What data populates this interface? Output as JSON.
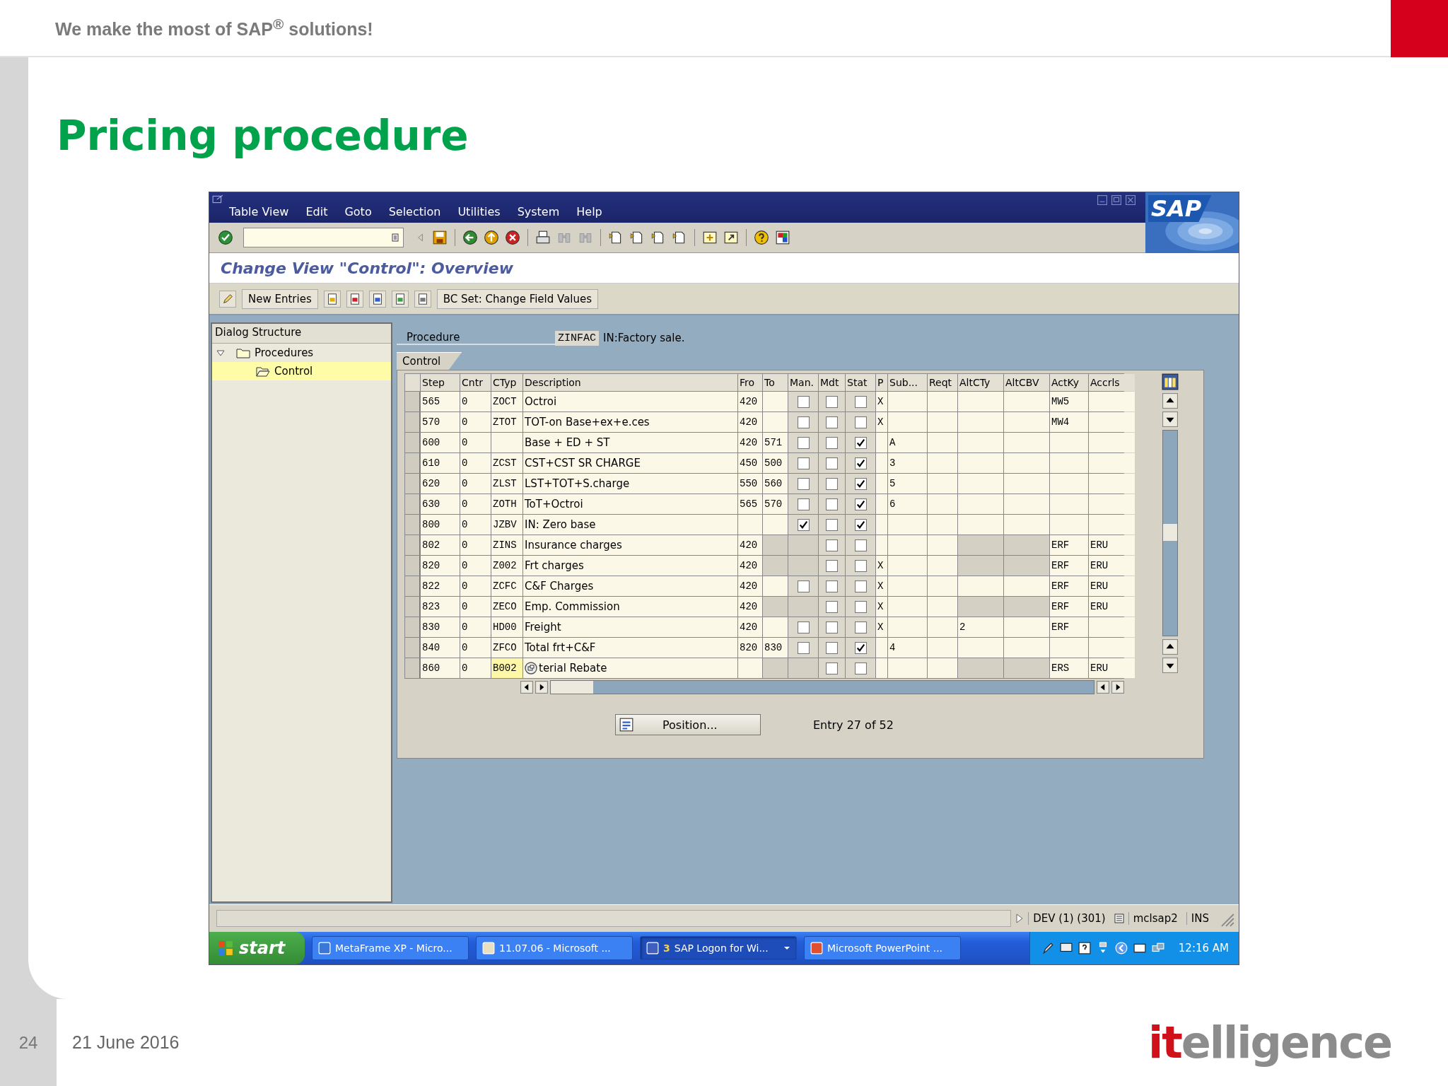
{
  "slide": {
    "tagline": "We make the most of SAP$^{®}$ solutions!",
    "title": "Pricing procedure",
    "page_number": "24",
    "date": "21 June 2016",
    "logo_parts": [
      "it",
      "elligence"
    ]
  },
  "sap": {
    "menu": [
      "Table View",
      "Edit",
      "Goto",
      "Selection",
      "Utilities",
      "System",
      "Help"
    ],
    "logo": "SAP",
    "screen_title": "Change View \"Control\": Overview",
    "new_entries_button": "New Entries",
    "bc_set_button": "BC Set: Change Field Values",
    "dialog_structure": {
      "title": "Dialog Structure",
      "tree": [
        {
          "label": "Procedures",
          "expanded": true,
          "selected": false,
          "children": [
            {
              "label": "Control",
              "selected": true
            }
          ]
        }
      ]
    },
    "procedure": {
      "label": "Procedure",
      "value": "ZINFAC",
      "description": "IN:Factory sale."
    },
    "tab": "Control",
    "table": {
      "columns": [
        "Step",
        "Cntr",
        "CTyp",
        "Description",
        "Fro",
        "To",
        "Man.",
        "Mdt",
        "Stat",
        "P",
        "Sub...",
        "Reqt",
        "AltCTy",
        "AltCBV",
        "ActKy",
        "Accrls"
      ],
      "rows": [
        {
          "step": "565",
          "cntr": "0",
          "ctyp": "ZOCT",
          "description": "Octroi",
          "fro": "420",
          "man": false,
          "mdt": false,
          "stat": false,
          "p": "X",
          "actky": "MW5",
          "locked": false,
          "focused": false
        },
        {
          "step": "570",
          "cntr": "0",
          "ctyp": "ZTOT",
          "description": "TOT-on Base+ex+e.ces",
          "fro": "420",
          "man": false,
          "mdt": false,
          "stat": false,
          "p": "X",
          "actky": "MW4",
          "locked": false,
          "focused": false
        },
        {
          "step": "600",
          "cntr": "0",
          "description": "Base + ED + ST",
          "fro": "420",
          "to": "571",
          "man": false,
          "mdt": false,
          "stat": true,
          "sub": "A",
          "locked": false,
          "focused": false
        },
        {
          "step": "610",
          "cntr": "0",
          "ctyp": "ZCST",
          "description": "CST+CST SR CHARGE",
          "fro": "450",
          "to": "500",
          "man": false,
          "mdt": false,
          "stat": true,
          "sub": "3",
          "locked": false,
          "focused": false
        },
        {
          "step": "620",
          "cntr": "0",
          "ctyp": "ZLST",
          "description": "LST+TOT+S.charge",
          "fro": "550",
          "to": "560",
          "man": false,
          "mdt": false,
          "stat": true,
          "sub": "5",
          "locked": false,
          "focused": false
        },
        {
          "step": "630",
          "cntr": "0",
          "ctyp": "ZOTH",
          "description": "ToT+Octroi",
          "fro": "565",
          "to": "570",
          "man": false,
          "mdt": false,
          "stat": true,
          "sub": "6",
          "locked": false,
          "focused": false
        },
        {
          "step": "800",
          "cntr": "0",
          "ctyp": "JZBV",
          "description": "IN: Zero base",
          "man": true,
          "mdt": false,
          "stat": true,
          "locked": false,
          "focused": false
        },
        {
          "step": "802",
          "cntr": "0",
          "ctyp": "ZINS",
          "description": "Insurance charges",
          "fro": "420",
          "mdt": false,
          "stat": false,
          "actky": "ERF",
          "accrls": "ERU",
          "locked": true,
          "focused": false
        },
        {
          "step": "820",
          "cntr": "0",
          "ctyp": "Z002",
          "description": "Frt charges",
          "fro": "420",
          "mdt": false,
          "stat": false,
          "p": "X",
          "actky": "ERF",
          "accrls": "ERU",
          "locked": true,
          "focused": false
        },
        {
          "step": "822",
          "cntr": "0",
          "ctyp": "ZCFC",
          "description": "C&F Charges",
          "fro": "420",
          "man": false,
          "mdt": false,
          "stat": false,
          "p": "X",
          "actky": "ERF",
          "accrls": "ERU",
          "locked": false,
          "focused": false
        },
        {
          "step": "823",
          "cntr": "0",
          "ctyp": "ZECO",
          "description": "Emp. Commission",
          "fro": "420",
          "mdt": false,
          "stat": false,
          "p": "X",
          "actky": "ERF",
          "accrls": "ERU",
          "locked": true,
          "focused": false
        },
        {
          "step": "830",
          "cntr": "0",
          "ctyp": "HD00",
          "description": "Freight",
          "fro": "420",
          "man": false,
          "mdt": false,
          "stat": false,
          "p": "X",
          "altcty": "2",
          "actky": "ERF",
          "locked": false,
          "focused": false
        },
        {
          "step": "840",
          "cntr": "0",
          "ctyp": "ZFCO",
          "description": "Total frt+C&F",
          "fro": "820",
          "to": "830",
          "man": false,
          "mdt": false,
          "stat": true,
          "sub": "4",
          "locked": false,
          "focused": false
        },
        {
          "step": "860",
          "cntr": "0",
          "ctyp": "B002",
          "description": "terial Rebate",
          "mdt": false,
          "stat": false,
          "actky": "ERS",
          "accrls": "ERU",
          "locked": true,
          "focused": true
        }
      ]
    },
    "position_button": "Position...",
    "entry_info": "Entry 27 of 52",
    "status_bar": {
      "system": "DEV (1) (301)",
      "server": "mclsap2",
      "mode": "INS"
    },
    "taskbar": {
      "start": "start",
      "tasks": [
        {
          "label": "MetaFrame XP - Micro...",
          "selected": false
        },
        {
          "label": "11.07.06 - Microsoft ...",
          "selected": false
        },
        {
          "count": "3",
          "label": "SAP Logon for Wi...",
          "selected": true
        },
        {
          "label": "Microsoft PowerPoint ...",
          "selected": false
        }
      ],
      "clock": "12:16 AM"
    }
  }
}
